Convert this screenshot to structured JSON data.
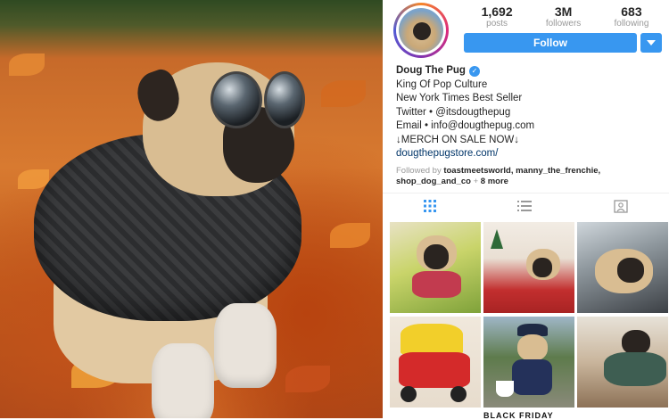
{
  "profile": {
    "stats": [
      {
        "value": "1,692",
        "label": "posts"
      },
      {
        "value": "3M",
        "label": "followers"
      },
      {
        "value": "683",
        "label": "following"
      }
    ],
    "follow_label": "Follow",
    "name": "Doug The Pug",
    "bio_lines": [
      "King Of Pop Culture",
      "New York Times Best Seller",
      "Twitter • @itsdougthepug",
      "Email • info@dougthepug.com",
      "↓MERCH ON SALE NOW↓"
    ],
    "website": "dougthepugstore.com/",
    "followed_by": {
      "prefix": "Followed by ",
      "names": "toastmeetsworld, manny_the_frenchie, shop_dog_and_co",
      "suffix": " + ",
      "more": "8 more"
    }
  },
  "tabs": [
    {
      "icon": "grid-icon",
      "active": true
    },
    {
      "icon": "list-icon",
      "active": false
    },
    {
      "icon": "tagged-icon",
      "active": false
    }
  ],
  "grid_partial_text": "BLACK FRIDAY SALE",
  "colors": {
    "accent": "#3897f0",
    "link": "#003569",
    "muted": "#999999"
  }
}
